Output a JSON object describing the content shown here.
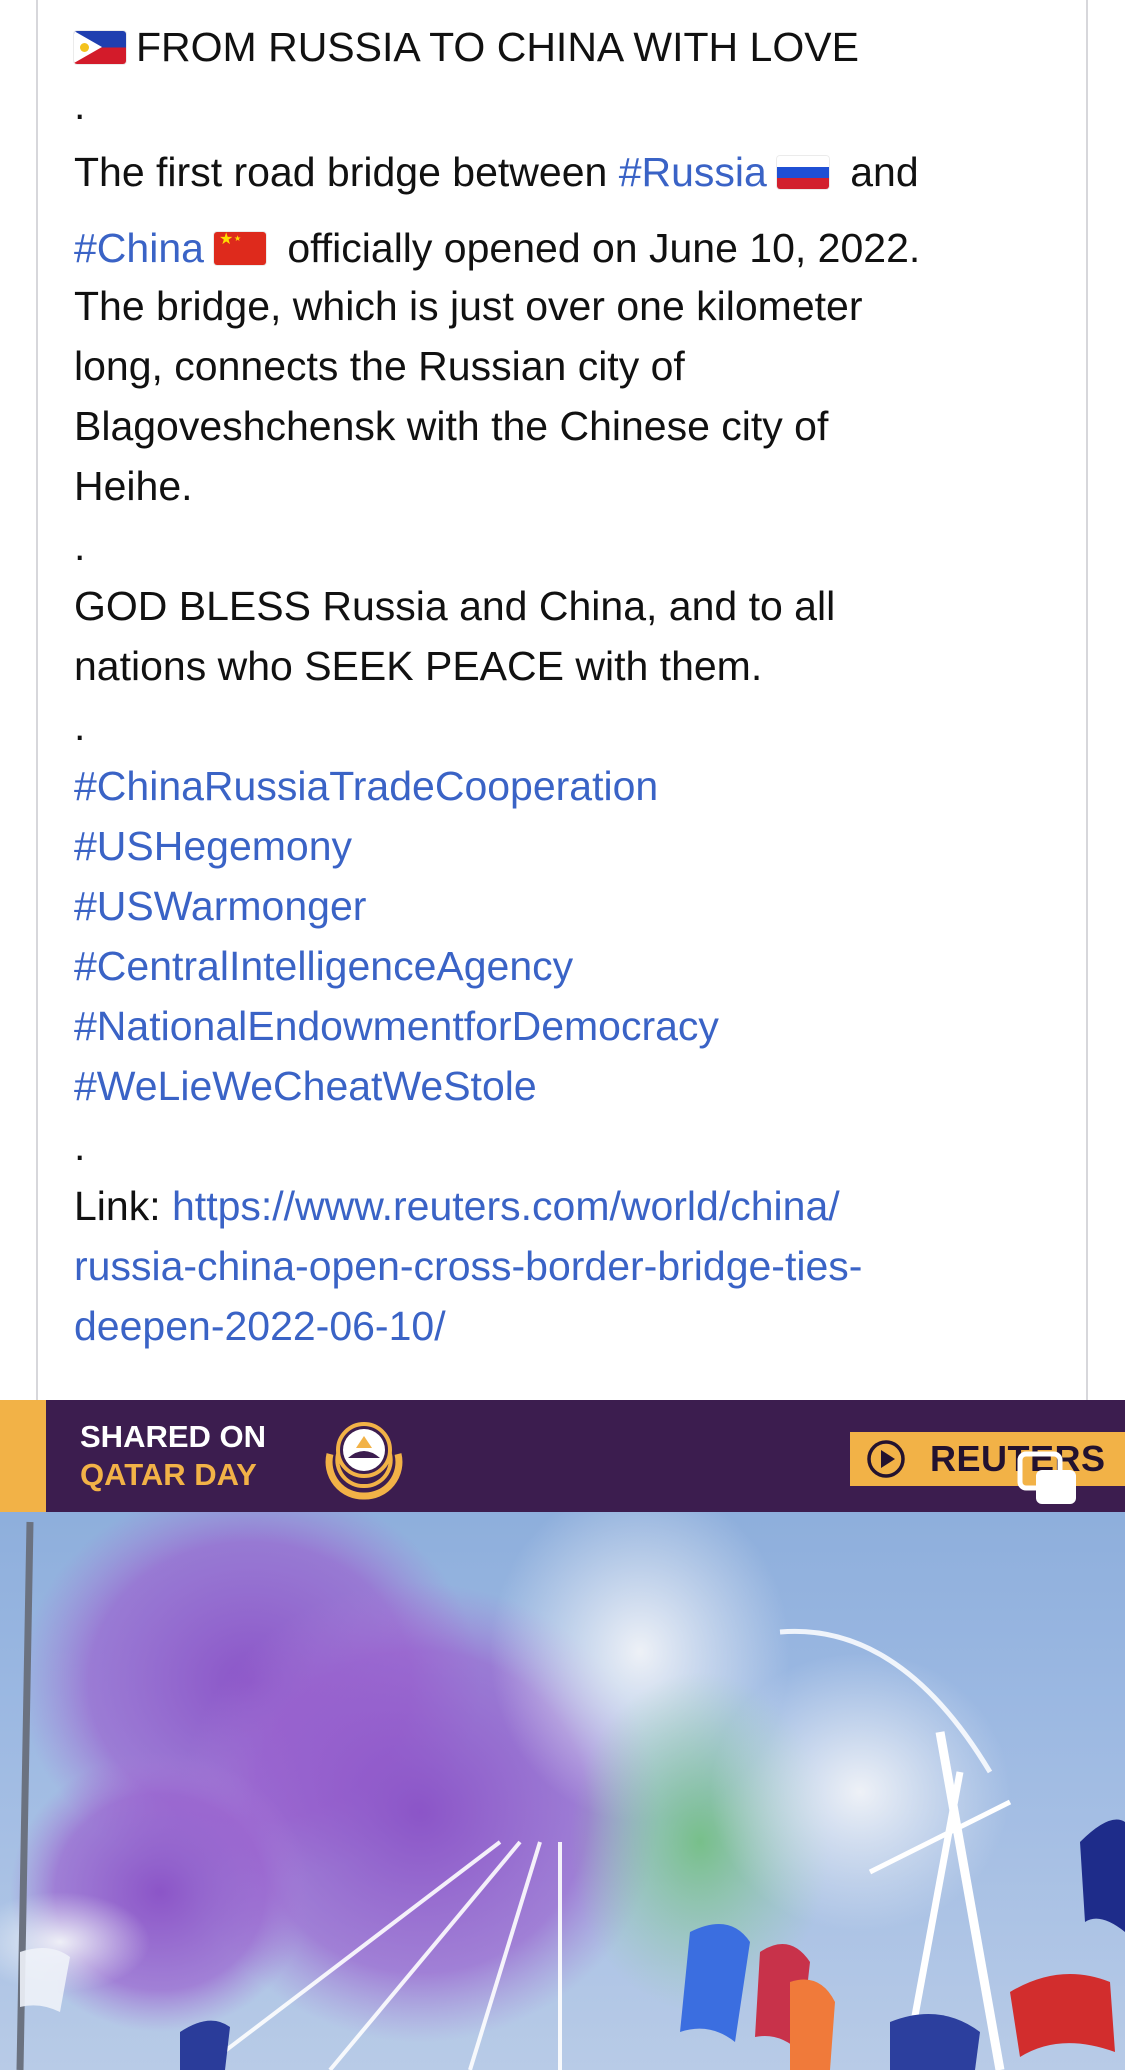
{
  "post": {
    "title": "FROM RUSSIA TO CHINA WITH LOVE",
    "dot": ".",
    "p1_before_russia": "The first road bridge between ",
    "tag_russia": "#Russia",
    "p1_and": " and",
    "tag_china": "#China",
    "p1_after_china": " officially opened on June 10, 2022.",
    "p1_lines": [
      "The bridge, which is just over one kilometer",
      "long, connects the Russian city of",
      "Blagoveshchensk with the Chinese city of",
      "Heihe."
    ],
    "p2_lines": [
      "GOD BLESS Russia and China, and to all",
      "nations who SEEK PEACE with them."
    ],
    "hashtags": [
      "#ChinaRussiaTradeCooperation",
      "#USHegemony",
      "#USWarmonger",
      "#CentralIntelligenceAgency",
      "#NationalEndowmentforDemocracy",
      "#WeLieWeCheatWeStole"
    ],
    "link_label": "Link: ",
    "link_lines": [
      "https://www.reuters.com/world/china/",
      "russia-china-open-cross-border-bridge-ties-",
      "deepen-2022-06-10/"
    ]
  },
  "media": {
    "banner_line1": "SHARED ON",
    "banner_line2": "QATAR DAY",
    "source_tag": "REUTERS",
    "multi_photo_icon": "multiple-media-icon",
    "colors": {
      "banner_bg": "#3c1d4f",
      "banner_accent": "#f2b247"
    }
  },
  "colors": {
    "link": "#3a63c6",
    "text": "#111111",
    "card_border": "#d7d7db"
  }
}
